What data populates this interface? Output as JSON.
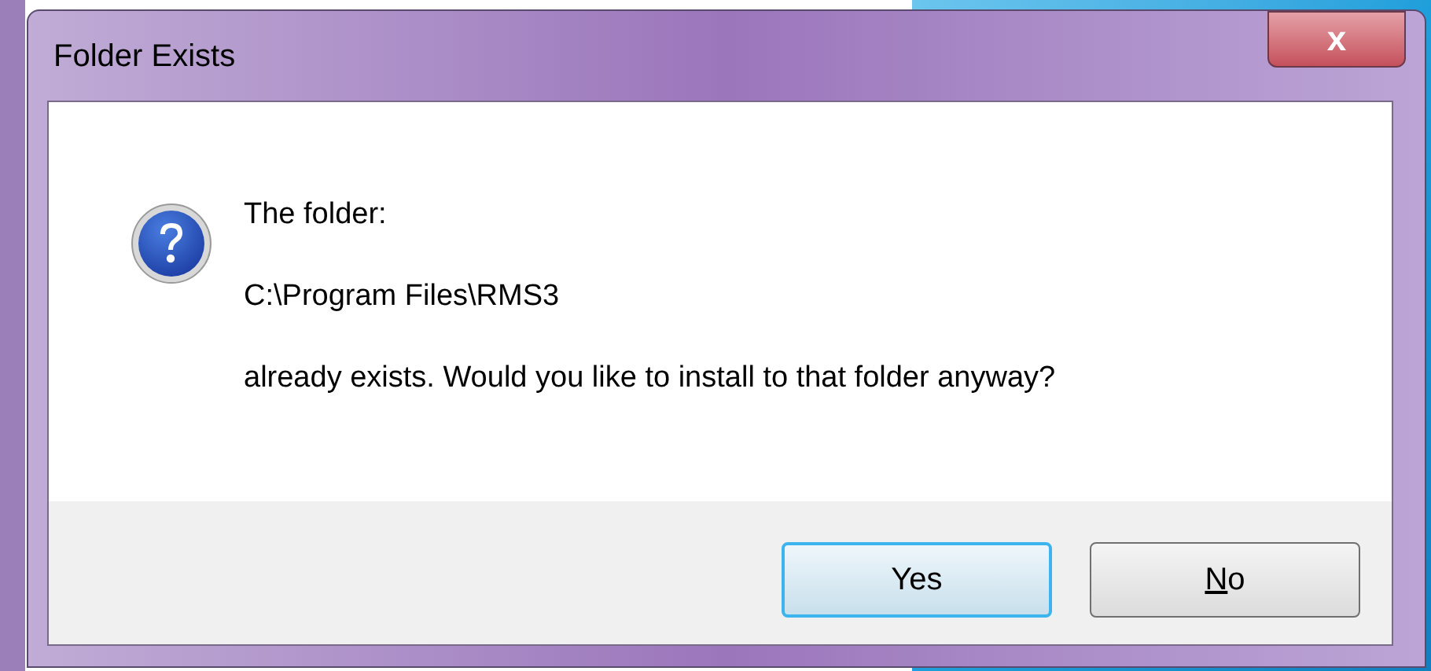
{
  "window": {
    "title": "Folder Exists",
    "close_label": "x"
  },
  "message": [
    "The folder:",
    "C:\\Program Files\\RMS3",
    "already exists. Would you like to install to that folder anyway?"
  ],
  "buttons": [
    {
      "label": "Yes",
      "default": true,
      "mnemonic": false
    },
    {
      "label": "No",
      "default": false,
      "mnemonic": true
    }
  ]
}
